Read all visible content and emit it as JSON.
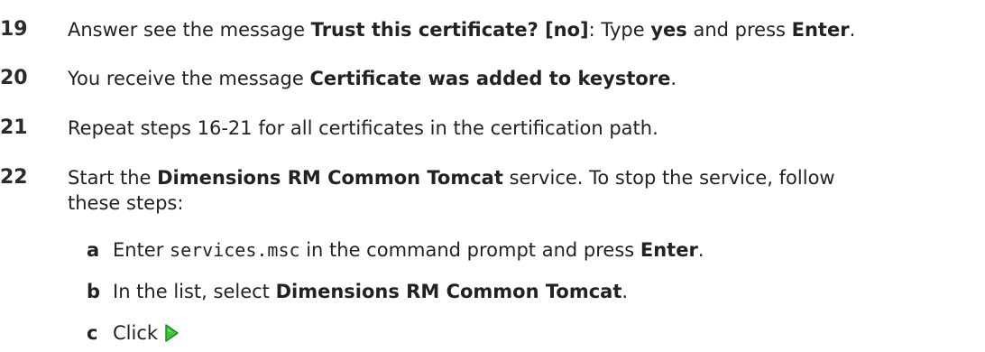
{
  "steps": [
    {
      "number": "19",
      "parts": [
        "Answer see the message ",
        "Trust this certificate? [no]",
        ": Type ",
        "yes",
        " and press ",
        "Enter",
        "."
      ]
    },
    {
      "number": "20",
      "parts": [
        "You receive the message ",
        "Certificate was added to keystore",
        "."
      ]
    },
    {
      "number": "21",
      "text": "Repeat steps 16-21 for all certificates in the certification path."
    },
    {
      "number": "22",
      "parts": [
        "Start the ",
        "Dimensions RM Common Tomcat",
        " service. To stop the service, follow"
      ],
      "line2": "these steps:",
      "substeps": [
        {
          "letter": "a",
          "parts": [
            "Enter ",
            "services.msc",
            " in the command prompt and press ",
            "Enter",
            "."
          ]
        },
        {
          "letter": "b",
          "parts": [
            "In the list, select ",
            "Dimensions RM Common Tomcat",
            "."
          ]
        },
        {
          "letter": "c",
          "text": "Click",
          "icon": "green-play-icon"
        }
      ]
    }
  ],
  "colors": {
    "text": "#222222",
    "icon_fill": "#3ec23e",
    "icon_stroke": "#1f8a1f"
  }
}
